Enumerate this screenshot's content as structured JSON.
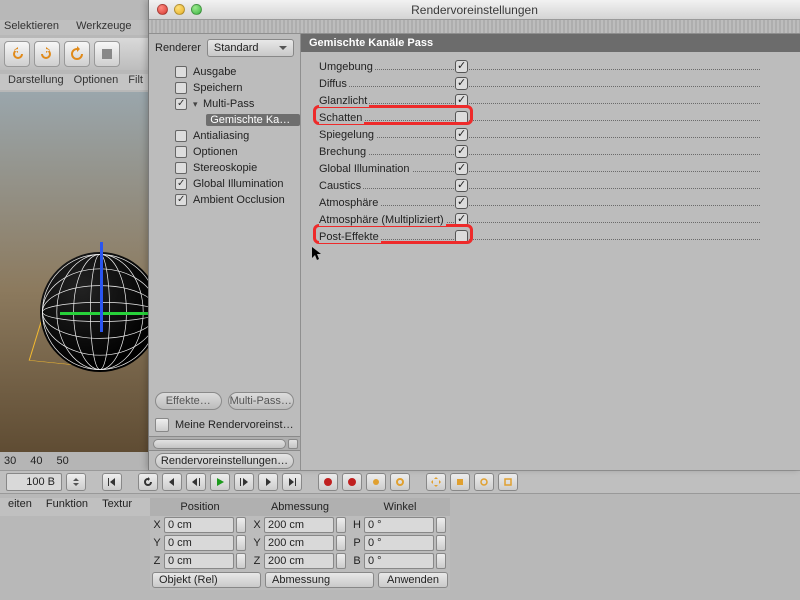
{
  "main_menu": {
    "items": [
      "Selektieren",
      "Werkzeuge"
    ]
  },
  "sub_menu": {
    "items": [
      "Darstellung",
      "Optionen",
      "Filt"
    ]
  },
  "ruler": {
    "ticks": [
      "30",
      "40",
      "50"
    ]
  },
  "playback": {
    "frame": "100 B"
  },
  "coord_tabs": {
    "items": [
      "eiten",
      "Funktion",
      "Textur"
    ]
  },
  "coord_headers": {
    "pos": "Position",
    "dim": "Abmessung",
    "ang": "Winkel"
  },
  "coords": {
    "rows": [
      {
        "axis": "X",
        "pos": "0 cm",
        "dim_axis": "X",
        "dim": "200 cm",
        "ang_axis": "H",
        "ang": "0 °"
      },
      {
        "axis": "Y",
        "pos": "0 cm",
        "dim_axis": "Y",
        "dim": "200 cm",
        "ang_axis": "P",
        "ang": "0 °"
      },
      {
        "axis": "Z",
        "pos": "0 cm",
        "dim_axis": "Z",
        "dim": "200 cm",
        "ang_axis": "B",
        "ang": "0 °"
      }
    ],
    "mode1": "Objekt (Rel)",
    "mode2": "Abmessung",
    "apply": "Anwenden"
  },
  "dialog": {
    "title": "Rendervoreinstellungen",
    "renderer_label": "Renderer",
    "renderer_value": "Standard",
    "tree": [
      {
        "label": "Ausgabe",
        "checked": false,
        "indent": 1
      },
      {
        "label": "Speichern",
        "checked": false,
        "indent": 1
      },
      {
        "label": "Multi-Pass",
        "checked": true,
        "indent": 1,
        "arrow": "▾"
      },
      {
        "label": "Gemischte Kanäle",
        "checked": null,
        "indent": 2,
        "selected": true
      },
      {
        "label": "Antialiasing",
        "checked": false,
        "indent": 1
      },
      {
        "label": "Optionen",
        "checked": false,
        "indent": 1
      },
      {
        "label": "Stereoskopie",
        "checked": false,
        "indent": 1
      },
      {
        "label": "Global Illumination",
        "checked": true,
        "indent": 1
      },
      {
        "label": "Ambient Occlusion",
        "checked": true,
        "indent": 1
      }
    ],
    "effects_btn": "Effekte…",
    "multipass_btn": "Multi-Pass…",
    "preset_current": "Meine Rendervoreinstellun",
    "preset_menu": "Rendervoreinstellungen…",
    "panel_title": "Gemischte Kanäle Pass",
    "passes": [
      {
        "label": "Umgebung",
        "checked": true
      },
      {
        "label": "Diffus",
        "checked": true
      },
      {
        "label": "Glanzlicht",
        "checked": true
      },
      {
        "label": "Schatten",
        "checked": false
      },
      {
        "label": "Spiegelung",
        "checked": true
      },
      {
        "label": "Brechung",
        "checked": true
      },
      {
        "label": "Global Illumination",
        "checked": true
      },
      {
        "label": "Caustics",
        "checked": true
      },
      {
        "label": "Atmosphäre",
        "checked": true
      },
      {
        "label": "Atmosphäre (Multipliziert)",
        "checked": true
      },
      {
        "label": "Post-Effekte",
        "checked": false
      }
    ]
  }
}
